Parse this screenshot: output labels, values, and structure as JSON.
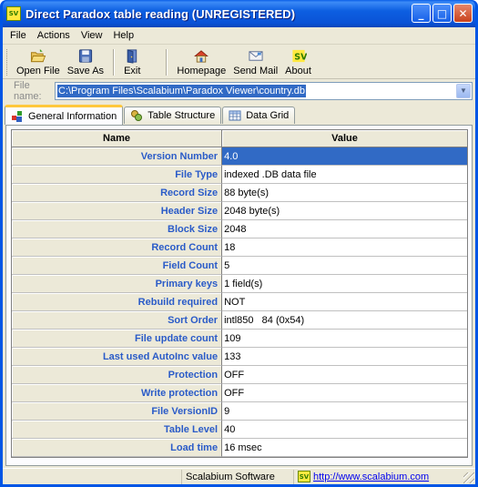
{
  "window": {
    "title": "Direct Paradox table reading (UNREGISTERED)",
    "icon": "app-logo-icon",
    "app_icon_text": "SV",
    "controls": {
      "minimize": "_",
      "maximize": "□",
      "close": "✕"
    }
  },
  "menu": [
    "File",
    "Actions",
    "View",
    "Help"
  ],
  "toolbar": {
    "open_file": "Open File",
    "save_as": "Save As",
    "exit": "Exit",
    "homepage": "Homepage",
    "send_mail": "Send Mail",
    "about": "About"
  },
  "file": {
    "label": "File name:",
    "value": "C:\\Program Files\\Scalabium\\Paradox Viewer\\country.db"
  },
  "tabs": [
    "General Information",
    "Table Structure",
    "Data Grid"
  ],
  "grid": {
    "headers": {
      "name": "Name",
      "value": "Value"
    },
    "rows": [
      {
        "name": "Version Number",
        "value": "4.0"
      },
      {
        "name": "File Type",
        "value": "indexed .DB data file"
      },
      {
        "name": "Record Size",
        "value": "88 byte(s)"
      },
      {
        "name": "Header Size",
        "value": "2048 byte(s)"
      },
      {
        "name": "Block Size",
        "value": "2048"
      },
      {
        "name": "Record Count",
        "value": "18"
      },
      {
        "name": "Field Count",
        "value": "5"
      },
      {
        "name": "Primary keys",
        "value": "1 field(s)"
      },
      {
        "name": "Rebuild required",
        "value": "NOT"
      },
      {
        "name": "Sort Order",
        "value": "intl850   84 (0x54)"
      },
      {
        "name": "File update count",
        "value": "109"
      },
      {
        "name": "Last used AutoInc value",
        "value": "133"
      },
      {
        "name": "Protection",
        "value": "OFF"
      },
      {
        "name": "Write protection",
        "value": "OFF"
      },
      {
        "name": "File VersionID",
        "value": "9"
      },
      {
        "name": "Table Level",
        "value": "40"
      },
      {
        "name": "Load time",
        "value": "16 msec"
      }
    ]
  },
  "status": {
    "company": "Scalabium Software",
    "logo_text": "SV",
    "url": "http://www.scalabium.com"
  },
  "colors": {
    "titlebar": "#0a52d6",
    "selection": "#316ac5",
    "name_text": "#2a5bc8",
    "tab_highlight": "#ffc83c"
  }
}
